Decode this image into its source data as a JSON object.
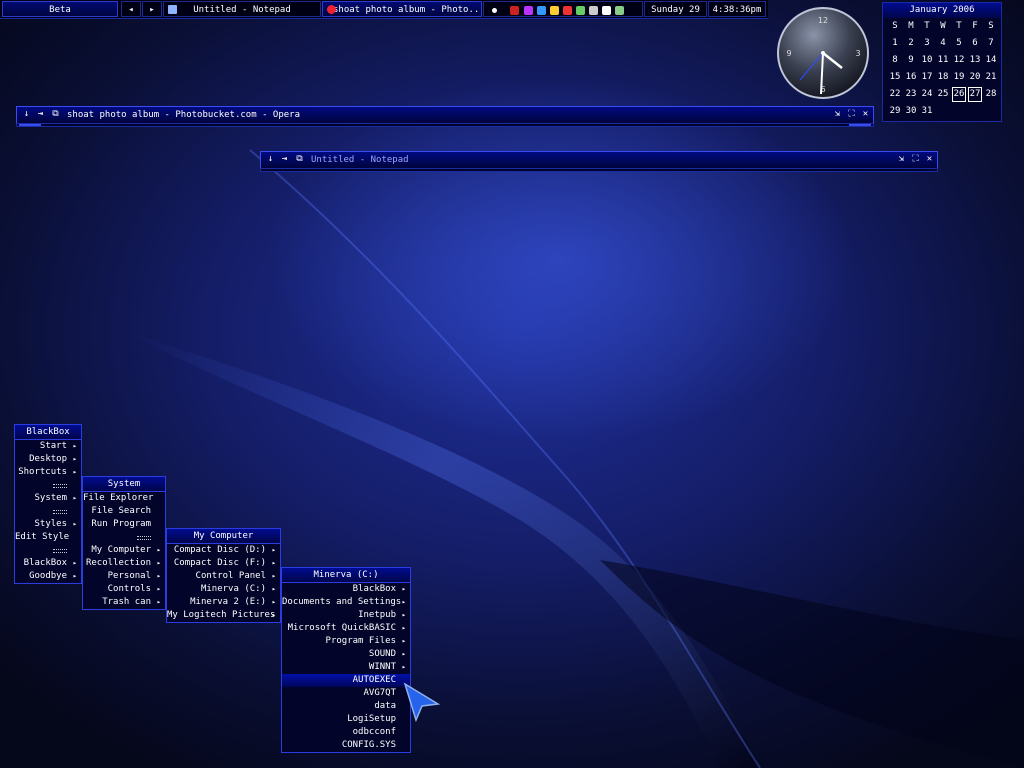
{
  "toolbar": {
    "workspace": "Beta",
    "prev_arrow": "◂",
    "next_arrow": "▸",
    "tasks": [
      "Untitled - Notepad",
      "shoat photo album - Photo..."
    ],
    "date": "Sunday 29",
    "time": "4:38:36pm",
    "tray_icons": [
      "opera-icon",
      "firewall-icon",
      "antivirus-icon",
      "network-icon",
      "alert-icon",
      "sound-icon",
      "volume-icon",
      "messenger-icon",
      "usb-icon"
    ]
  },
  "windows": [
    {
      "title": "shoat photo album - Photobucket.com - Opera"
    },
    {
      "title": "Untitled - Notepad"
    }
  ],
  "calendar": {
    "title": "January 2006",
    "weekdays": [
      "S",
      "M",
      "T",
      "W",
      "T",
      "F",
      "S"
    ],
    "days": [
      "1",
      "2",
      "3",
      "4",
      "5",
      "6",
      "7",
      "8",
      "9",
      "10",
      "11",
      "12",
      "13",
      "14",
      "15",
      "16",
      "17",
      "18",
      "19",
      "20",
      "21",
      "22",
      "23",
      "24",
      "25",
      "26",
      "27",
      "28",
      "29",
      "30",
      "31"
    ],
    "boxed_days": [
      "26",
      "27"
    ]
  },
  "clock": {
    "time_shown": "4:38",
    "numeral_12": "12",
    "numeral_3": "3",
    "numeral_9": "9",
    "numeral_6": "6"
  },
  "menus": {
    "blackbox": {
      "title": "BlackBox",
      "items": [
        {
          "label": "Start",
          "sub": true
        },
        {
          "label": "Desktop",
          "sub": true
        },
        {
          "label": "Shortcuts",
          "sub": true
        },
        {
          "sep": true
        },
        {
          "label": "System",
          "sub": true
        },
        {
          "sep": true
        },
        {
          "label": "Styles",
          "sub": true
        },
        {
          "label": "Edit Style",
          "sub": false
        },
        {
          "sep": true
        },
        {
          "label": "BlackBox",
          "sub": true
        },
        {
          "label": "Goodbye",
          "sub": true
        }
      ]
    },
    "system": {
      "title": "System",
      "items": [
        {
          "label": "File Explorer",
          "sub": false
        },
        {
          "label": "File Search",
          "sub": false
        },
        {
          "label": "Run Program",
          "sub": false
        },
        {
          "sep": true
        },
        {
          "label": "My Computer",
          "sub": true
        },
        {
          "label": "Recollection",
          "sub": true
        },
        {
          "label": "Personal",
          "sub": true
        },
        {
          "label": "Controls",
          "sub": true
        },
        {
          "label": "Trash can",
          "sub": true
        }
      ]
    },
    "mycomputer": {
      "title": "My Computer",
      "items": [
        {
          "label": "Compact Disc (D:)",
          "sub": true
        },
        {
          "label": "Compact Disc (F:)",
          "sub": true
        },
        {
          "label": "Control Panel",
          "sub": true
        },
        {
          "label": "Minerva (C:)",
          "sub": true
        },
        {
          "label": "Minerva 2 (E:)",
          "sub": true
        },
        {
          "label": "My Logitech Pictures",
          "sub": true
        }
      ]
    },
    "minerva": {
      "title": "Minerva (C:)",
      "items": [
        {
          "label": "BlackBox",
          "sub": true
        },
        {
          "label": "Documents and Settings",
          "sub": true
        },
        {
          "label": "Inetpub",
          "sub": true
        },
        {
          "label": "Microsoft QuickBASIC",
          "sub": true
        },
        {
          "label": "Program Files",
          "sub": true
        },
        {
          "label": "SOUND",
          "sub": true
        },
        {
          "label": "WINNT",
          "sub": true
        },
        {
          "label": "AUTOEXEC",
          "sub": false,
          "active": true
        },
        {
          "label": "AVG7QT",
          "sub": false
        },
        {
          "label": "data",
          "sub": false
        },
        {
          "label": "LogiSetup",
          "sub": false
        },
        {
          "label": "odbcconf",
          "sub": false
        },
        {
          "label": "CONFIG.SYS",
          "sub": false
        }
      ]
    }
  },
  "colors": {
    "accent": "#2a3de0",
    "bar": "#000a70",
    "text": "#ffffff"
  }
}
